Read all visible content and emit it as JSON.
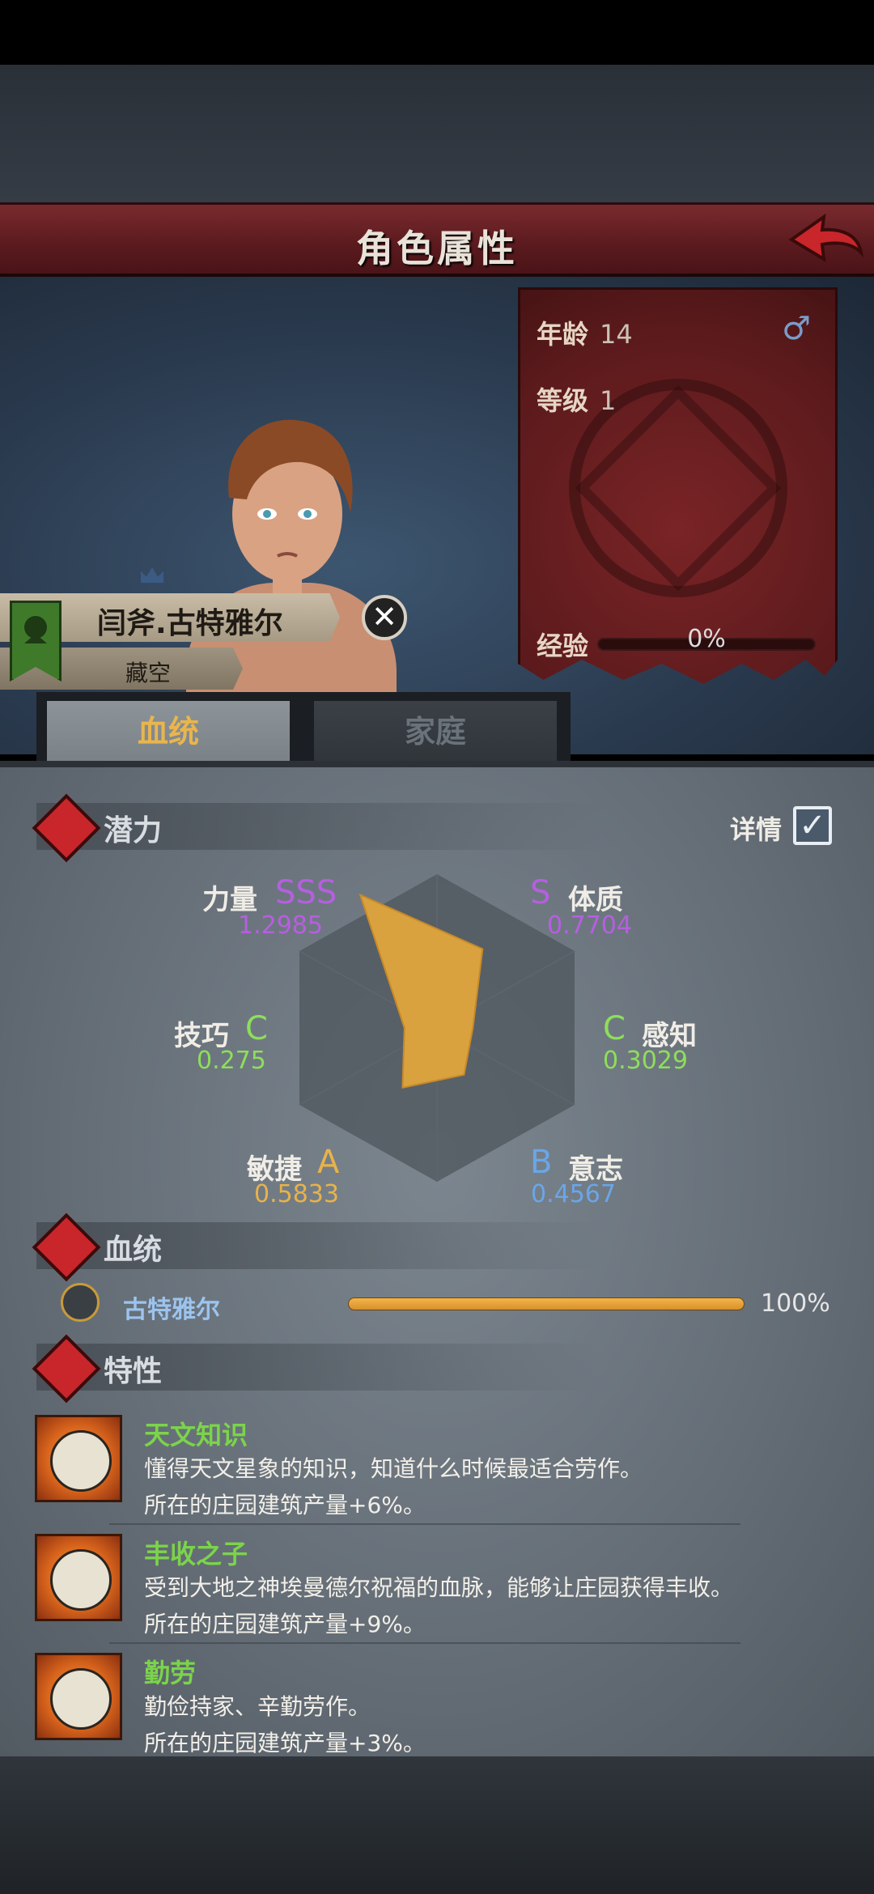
{
  "header": {
    "title": "角色属性"
  },
  "character": {
    "name": "闫斧.古特雅尔",
    "subtitle": "藏空",
    "age_label": "年龄",
    "age": "14",
    "level_label": "等级",
    "level": "1",
    "exp_label": "经验",
    "exp_pct": "0%",
    "gender_symbol": "♂"
  },
  "tabs": {
    "bloodline": "血统",
    "family": "家庭"
  },
  "potential": {
    "header": "潜力",
    "detail_label": "详情",
    "detail_checked": true,
    "attributes": [
      {
        "name": "力量",
        "grade": "SSS",
        "value": "1.2985",
        "color": "#b65fe0"
      },
      {
        "name": "体质",
        "grade": "S",
        "value": "0.7704",
        "color": "#b65fe0"
      },
      {
        "name": "感知",
        "grade": "C",
        "value": "0.3029",
        "color": "#8ddf5a"
      },
      {
        "name": "意志",
        "grade": "B",
        "value": "0.4567",
        "color": "#6aa6e8"
      },
      {
        "name": "敏捷",
        "grade": "A",
        "value": "0.5833",
        "color": "#e8b24a"
      },
      {
        "name": "技巧",
        "grade": "C",
        "value": "0.275",
        "color": "#8ddf5a"
      }
    ]
  },
  "lineage": {
    "header": "血统",
    "name": "古特雅尔",
    "pct": "100%",
    "fill": 1.0
  },
  "traits": {
    "header": "特性",
    "items": [
      {
        "name": "天文知识",
        "desc": "懂得天文星象的知识，知道什么时候最适合劳作。",
        "effect": "所在的庄园建筑产量+6%。"
      },
      {
        "name": "丰收之子",
        "desc": "受到大地之神埃曼德尔祝福的血脉，能够让庄园获得丰收。",
        "effect": "所在的庄园建筑产量+9%。"
      },
      {
        "name": "勤劳",
        "desc": "勤俭持家、辛勤劳作。",
        "effect": "所在的庄园建筑产量+3%。"
      }
    ]
  },
  "colors": {
    "accent_gold": "#e9b54c",
    "panel_red": "#5b1a1c",
    "trait_green": "#7bd44a"
  }
}
